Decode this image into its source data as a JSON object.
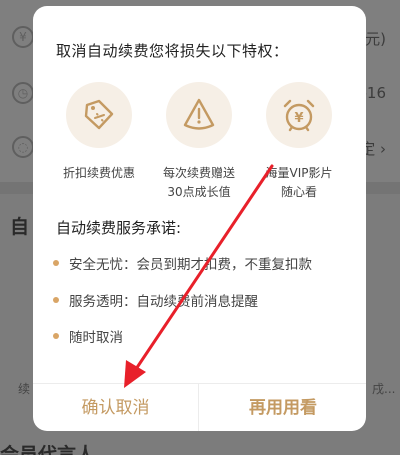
{
  "background": {
    "rows": [
      {
        "icon": "yuan-icon",
        "icon_glyph": "¥",
        "right_text": "元)"
      },
      {
        "icon": "clock-icon",
        "icon_glyph": "◷",
        "right_text": "-16"
      },
      {
        "icon": "card-icon",
        "icon_glyph": "◌",
        "right_text": "定 ›"
      }
    ],
    "heading_partial": "自",
    "left_small": "续",
    "right_small": "戌...",
    "bottom_title": "会员代言人"
  },
  "modal": {
    "title": "取消自动续费您将损失以下特权：",
    "benefits": [
      {
        "icon": "discount-tag-icon",
        "line1": "折扣续费优惠",
        "line2": ""
      },
      {
        "icon": "growth-bell-icon",
        "line1": "每次续费赠送",
        "line2": "30点成长值"
      },
      {
        "icon": "vip-alarm-icon",
        "line1": "海量VIP影片",
        "line2": "随心看"
      }
    ],
    "promise_title": "自动续费服务承诺:",
    "promises": [
      "安全无忧：会员到期才扣费，不重复扣款",
      "服务透明：自动续费前消息提醒",
      "随时取消"
    ],
    "confirm_label": "确认取消",
    "keep_label": "再用用看"
  },
  "colors": {
    "accent": "#c49a62",
    "dot": "#d9a566",
    "icon_bg": "#f6efe6",
    "arrow": "#e8202a"
  }
}
